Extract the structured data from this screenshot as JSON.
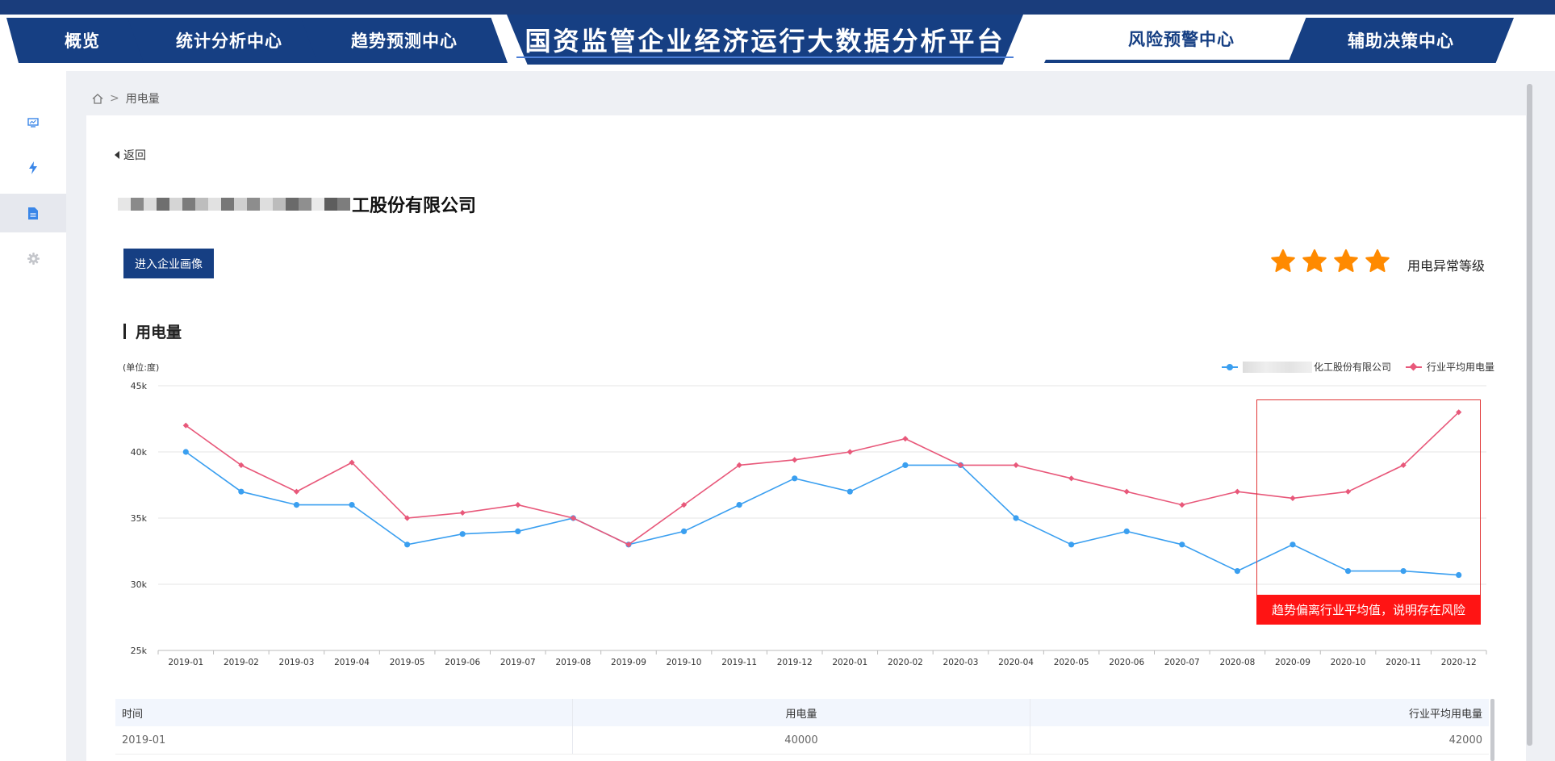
{
  "nav": {
    "tabs_left": [
      "概览",
      "统计分析中心",
      "趋势预测中心"
    ],
    "title": "国资监管企业经济运行大数据分析平台",
    "tabs_right": [
      {
        "label": "风险预警中心",
        "active": true
      },
      {
        "label": "辅助决策中心",
        "active": false
      }
    ]
  },
  "sidebar": {
    "items": [
      {
        "icon": "monitor-icon",
        "active": false
      },
      {
        "icon": "lightning-icon",
        "active": false
      },
      {
        "icon": "document-icon",
        "active": true
      },
      {
        "icon": "gear-icon",
        "active": false
      }
    ]
  },
  "breadcrumb": {
    "separator": ">",
    "current": "用电量"
  },
  "detail": {
    "back_label": "返回",
    "company_name_visible": "工股份有限公司",
    "profile_button": "进入企业画像",
    "anomaly_level_label": "用电异常等级",
    "anomaly_level_stars": 4,
    "section_title": "用电量"
  },
  "colors": {
    "primary": "#163f83",
    "company_series": "#3a9ff0",
    "industry_series": "#e8587a",
    "alert": "#ff1414",
    "star": "#ff8a00"
  },
  "chart_data": {
    "type": "line",
    "ylabel": "(单位:度)",
    "ylim": [
      25000,
      45000
    ],
    "yticks": [
      {
        "value": 25000,
        "label": "25k"
      },
      {
        "value": 30000,
        "label": "30k"
      },
      {
        "value": 35000,
        "label": "35k"
      },
      {
        "value": 40000,
        "label": "40k"
      },
      {
        "value": 45000,
        "label": "45k"
      }
    ],
    "categories": [
      "2019-01",
      "2019-02",
      "2019-03",
      "2019-04",
      "2019-05",
      "2019-06",
      "2019-07",
      "2019-08",
      "2019-09",
      "2019-10",
      "2019-11",
      "2019-12",
      "2020-01",
      "2020-02",
      "2020-03",
      "2020-04",
      "2020-05",
      "2020-06",
      "2020-07",
      "2020-08",
      "2020-09",
      "2020-10",
      "2020-11",
      "2020-12"
    ],
    "grid": true,
    "legend": "top-right",
    "series": [
      {
        "name": "工股份有限公司",
        "legend_label": "化工股份有限公司",
        "color": "#3a9ff0",
        "marker": "circle",
        "values": [
          40000,
          37000,
          36000,
          36000,
          33000,
          33800,
          34000,
          35000,
          33000,
          34000,
          36000,
          38000,
          37000,
          39000,
          39000,
          35000,
          33000,
          34000,
          33000,
          31000,
          33000,
          31000,
          31000,
          30700
        ]
      },
      {
        "name": "行业平均用电量",
        "legend_label": "行业平均用电量",
        "color": "#e8587a",
        "marker": "diamond",
        "values": [
          42000,
          39000,
          37000,
          39200,
          35000,
          35400,
          36000,
          35000,
          33000,
          36000,
          39000,
          39400,
          40000,
          41000,
          39000,
          39000,
          38000,
          37000,
          36000,
          37000,
          36500,
          37000,
          39000,
          43000
        ]
      }
    ],
    "annotation": {
      "text": "趋势偏离行业平均值，说明存在风险",
      "from": "2020-09",
      "to": "2020-12"
    }
  },
  "table": {
    "headers": [
      "时间",
      "用电量",
      "行业平均用电量"
    ],
    "rows": [
      [
        "2019-01",
        "40000",
        "42000"
      ]
    ]
  }
}
